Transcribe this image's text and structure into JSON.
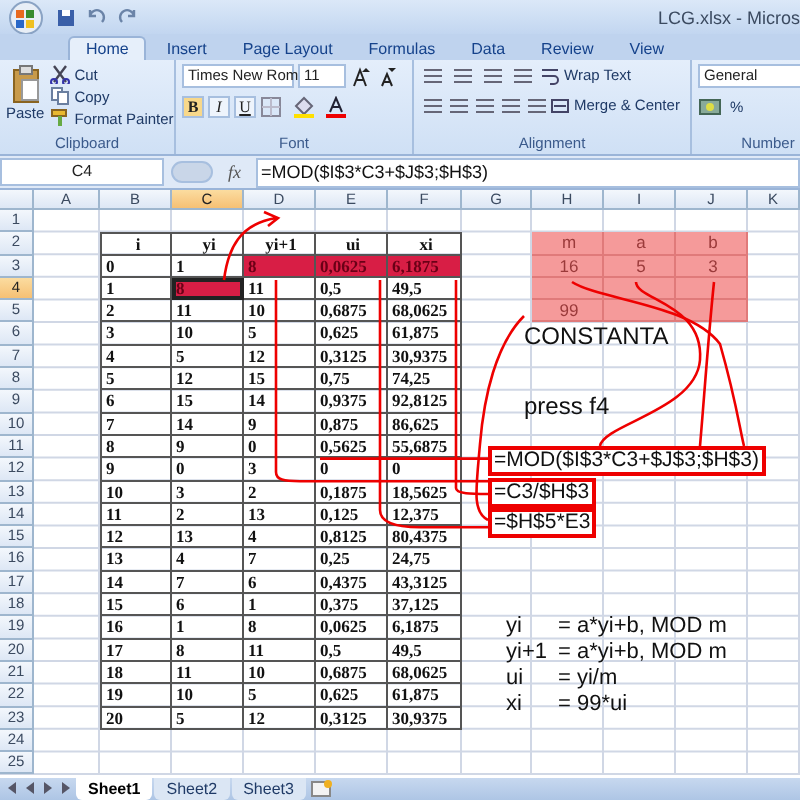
{
  "window": {
    "title": "LCG.xlsx - Micros"
  },
  "tabs": [
    {
      "label": "Home",
      "selected": true
    },
    {
      "label": "Insert",
      "selected": false
    },
    {
      "label": "Page Layout",
      "selected": false
    },
    {
      "label": "Formulas",
      "selected": false
    },
    {
      "label": "Data",
      "selected": false
    },
    {
      "label": "Review",
      "selected": false
    },
    {
      "label": "View",
      "selected": false
    }
  ],
  "ribbon": {
    "clipboard": {
      "label": "Clipboard",
      "paste": "Paste",
      "cut": "Cut",
      "copy": "Copy",
      "format_painter": "Format Painter"
    },
    "font": {
      "label": "Font",
      "name": "Times New Rom",
      "size": "11",
      "bold": "B",
      "italic": "I",
      "underline": "U"
    },
    "alignment": {
      "label": "Alignment",
      "wrap_text": "Wrap Text",
      "merge_center": "Merge & Center"
    },
    "number": {
      "label": "Number",
      "format": "General",
      "percent": "%"
    }
  },
  "formula_bar": {
    "name_box": "C4",
    "fx": "fx",
    "formula": "=MOD($I$3*C3+$J$3;$H$3)"
  },
  "columns": [
    {
      "label": "A",
      "selected": false
    },
    {
      "label": "B",
      "selected": false
    },
    {
      "label": "C",
      "selected": true
    },
    {
      "label": "D",
      "selected": false
    },
    {
      "label": "E",
      "selected": false
    },
    {
      "label": "F",
      "selected": false
    },
    {
      "label": "G",
      "selected": false
    },
    {
      "label": "H",
      "selected": false
    },
    {
      "label": "I",
      "selected": false
    },
    {
      "label": "J",
      "selected": false
    },
    {
      "label": "K",
      "selected": false
    }
  ],
  "rows": [
    {
      "label": "1",
      "selected": false
    },
    {
      "label": "2",
      "selected": false
    },
    {
      "label": "3",
      "selected": false
    },
    {
      "label": "4",
      "selected": true
    },
    {
      "label": "5",
      "selected": false
    },
    {
      "label": "6",
      "selected": false
    },
    {
      "label": "7",
      "selected": false
    },
    {
      "label": "8",
      "selected": false
    },
    {
      "label": "9",
      "selected": false
    },
    {
      "label": "10",
      "selected": false
    },
    {
      "label": "11",
      "selected": false
    },
    {
      "label": "12",
      "selected": false
    },
    {
      "label": "13",
      "selected": false
    },
    {
      "label": "14",
      "selected": false
    },
    {
      "label": "15",
      "selected": false
    },
    {
      "label": "16",
      "selected": false
    },
    {
      "label": "17",
      "selected": false
    },
    {
      "label": "18",
      "selected": false
    },
    {
      "label": "19",
      "selected": false
    },
    {
      "label": "20",
      "selected": false
    },
    {
      "label": "21",
      "selected": false
    },
    {
      "label": "22",
      "selected": false
    },
    {
      "label": "23",
      "selected": false
    },
    {
      "label": "24",
      "selected": false
    },
    {
      "label": "25",
      "selected": false
    }
  ],
  "table": {
    "headers": [
      "i",
      "yi",
      "yi+1",
      "ui",
      "xi"
    ],
    "rows": [
      {
        "cells": [
          "0",
          "1",
          "8",
          "0,0625",
          "6,1875"
        ],
        "highlighted": [
          false,
          false,
          true,
          true,
          true
        ]
      },
      {
        "cells": [
          "1",
          "8",
          "11",
          "0,5",
          "49,5"
        ],
        "highlighted": [
          false,
          true,
          false,
          false,
          false
        ]
      },
      {
        "cells": [
          "2",
          "11",
          "10",
          "0,6875",
          "68,0625"
        ],
        "highlighted": [
          false,
          false,
          false,
          false,
          false
        ]
      },
      {
        "cells": [
          "3",
          "10",
          "5",
          "0,625",
          "61,875"
        ],
        "highlighted": [
          false,
          false,
          false,
          false,
          false
        ]
      },
      {
        "cells": [
          "4",
          "5",
          "12",
          "0,3125",
          "30,9375"
        ],
        "highlighted": [
          false,
          false,
          false,
          false,
          false
        ]
      },
      {
        "cells": [
          "5",
          "12",
          "15",
          "0,75",
          "74,25"
        ],
        "highlighted": [
          false,
          false,
          false,
          false,
          false
        ]
      },
      {
        "cells": [
          "6",
          "15",
          "14",
          "0,9375",
          "92,8125"
        ],
        "highlighted": [
          false,
          false,
          false,
          false,
          false
        ]
      },
      {
        "cells": [
          "7",
          "14",
          "9",
          "0,875",
          "86,625"
        ],
        "highlighted": [
          false,
          false,
          false,
          false,
          false
        ]
      },
      {
        "cells": [
          "8",
          "9",
          "0",
          "0,5625",
          "55,6875"
        ],
        "highlighted": [
          false,
          false,
          false,
          false,
          false
        ]
      },
      {
        "cells": [
          "9",
          "0",
          "3",
          "0",
          "0"
        ],
        "highlighted": [
          false,
          false,
          false,
          false,
          false
        ]
      },
      {
        "cells": [
          "10",
          "3",
          "2",
          "0,1875",
          "18,5625"
        ],
        "highlighted": [
          false,
          false,
          false,
          false,
          false
        ]
      },
      {
        "cells": [
          "11",
          "2",
          "13",
          "0,125",
          "12,375"
        ],
        "highlighted": [
          false,
          false,
          false,
          false,
          false
        ]
      },
      {
        "cells": [
          "12",
          "13",
          "4",
          "0,8125",
          "80,4375"
        ],
        "highlighted": [
          false,
          false,
          false,
          false,
          false
        ]
      },
      {
        "cells": [
          "13",
          "4",
          "7",
          "0,25",
          "24,75"
        ],
        "highlighted": [
          false,
          false,
          false,
          false,
          false
        ]
      },
      {
        "cells": [
          "14",
          "7",
          "6",
          "0,4375",
          "43,3125"
        ],
        "highlighted": [
          false,
          false,
          false,
          false,
          false
        ]
      },
      {
        "cells": [
          "15",
          "6",
          "1",
          "0,375",
          "37,125"
        ],
        "highlighted": [
          false,
          false,
          false,
          false,
          false
        ]
      },
      {
        "cells": [
          "16",
          "1",
          "8",
          "0,0625",
          "6,1875"
        ],
        "highlighted": [
          false,
          false,
          false,
          false,
          false
        ]
      },
      {
        "cells": [
          "17",
          "8",
          "11",
          "0,5",
          "49,5"
        ],
        "highlighted": [
          false,
          false,
          false,
          false,
          false
        ]
      },
      {
        "cells": [
          "18",
          "11",
          "10",
          "0,6875",
          "68,0625"
        ],
        "highlighted": [
          false,
          false,
          false,
          false,
          false
        ]
      },
      {
        "cells": [
          "19",
          "10",
          "5",
          "0,625",
          "61,875"
        ],
        "highlighted": [
          false,
          false,
          false,
          false,
          false
        ]
      },
      {
        "cells": [
          "20",
          "5",
          "12",
          "0,3125",
          "30,9375"
        ],
        "highlighted": [
          false,
          false,
          false,
          false,
          false
        ]
      }
    ]
  },
  "constants": {
    "headers": [
      "m",
      "a",
      "b"
    ],
    "values": [
      "16",
      "5",
      "3"
    ],
    "total": "99"
  },
  "annotations": {
    "title": "CONSTANTA",
    "hint": "press f4",
    "formulas": [
      "=MOD($I$3*C3+$J$3;$H$3)",
      "=C3/$H$3",
      "=$H$5*E3"
    ],
    "notes": [
      {
        "name": "yi",
        "formula": "= a*yi+b, MOD m"
      },
      {
        "name": "yi+1",
        "formula": "= a*yi+b, MOD m"
      },
      {
        "name": "ui",
        "formula": "= yi/m"
      },
      {
        "name": "xi",
        "formula": "= 99*ui"
      }
    ]
  },
  "sheets": [
    {
      "label": "Sheet1",
      "selected": true
    },
    {
      "label": "Sheet2",
      "selected": false
    },
    {
      "label": "Sheet3",
      "selected": false
    }
  ]
}
